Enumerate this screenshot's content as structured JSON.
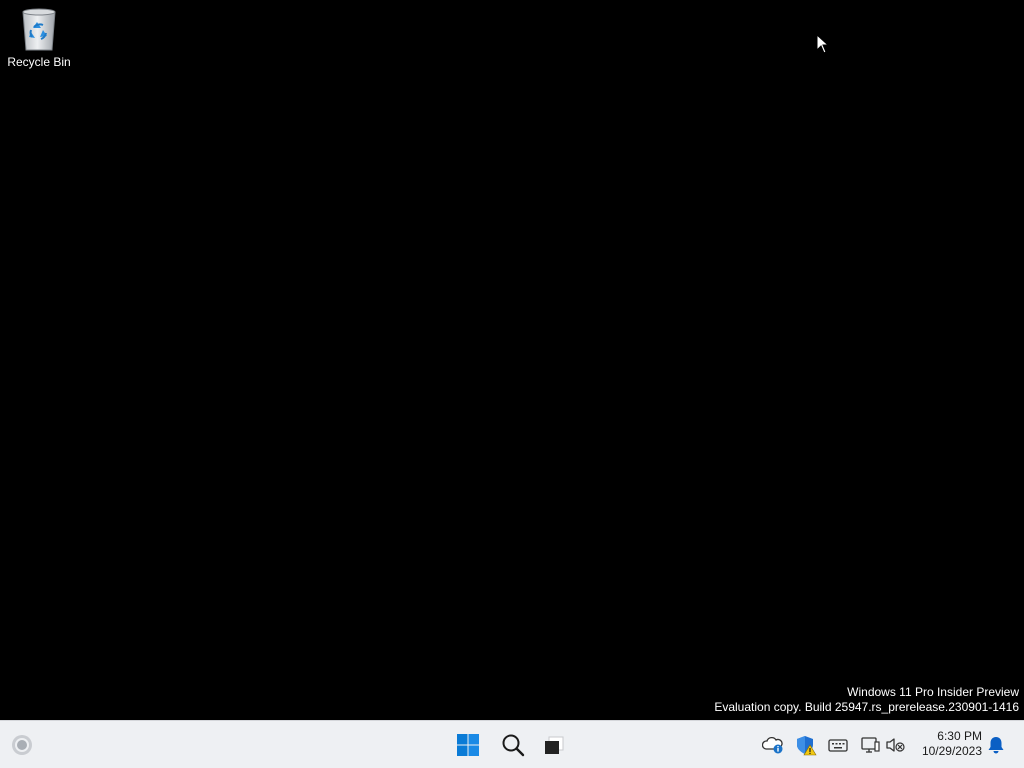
{
  "desktop": {
    "background_color": "#000000",
    "icons": [
      {
        "label": "Recycle Bin",
        "icon": "recycle-bin-icon"
      }
    ],
    "watermark": {
      "line1": "Windows 11 Pro Insider Preview",
      "line2": "Evaluation copy. Build 25947.rs_prerelease.230901-1416"
    }
  },
  "taskbar": {
    "background_color": "#eef0f3",
    "accent_color": "#0078d4",
    "left": [
      {
        "icon": "widgets-weather-icon"
      }
    ],
    "center": [
      {
        "icon": "windows-start-icon"
      },
      {
        "icon": "search-icon"
      },
      {
        "icon": "task-view-icon"
      }
    ],
    "tray": [
      {
        "icon": "onedrive-info-icon"
      },
      {
        "icon": "windows-security-warning-icon"
      },
      {
        "icon": "keyboard-icon"
      },
      {
        "icon": "network-icon"
      },
      {
        "icon": "volume-muted-icon"
      }
    ],
    "clock": {
      "time": "6:30 PM",
      "date": "10/29/2023"
    },
    "notification": {
      "icon": "bell-icon"
    }
  }
}
